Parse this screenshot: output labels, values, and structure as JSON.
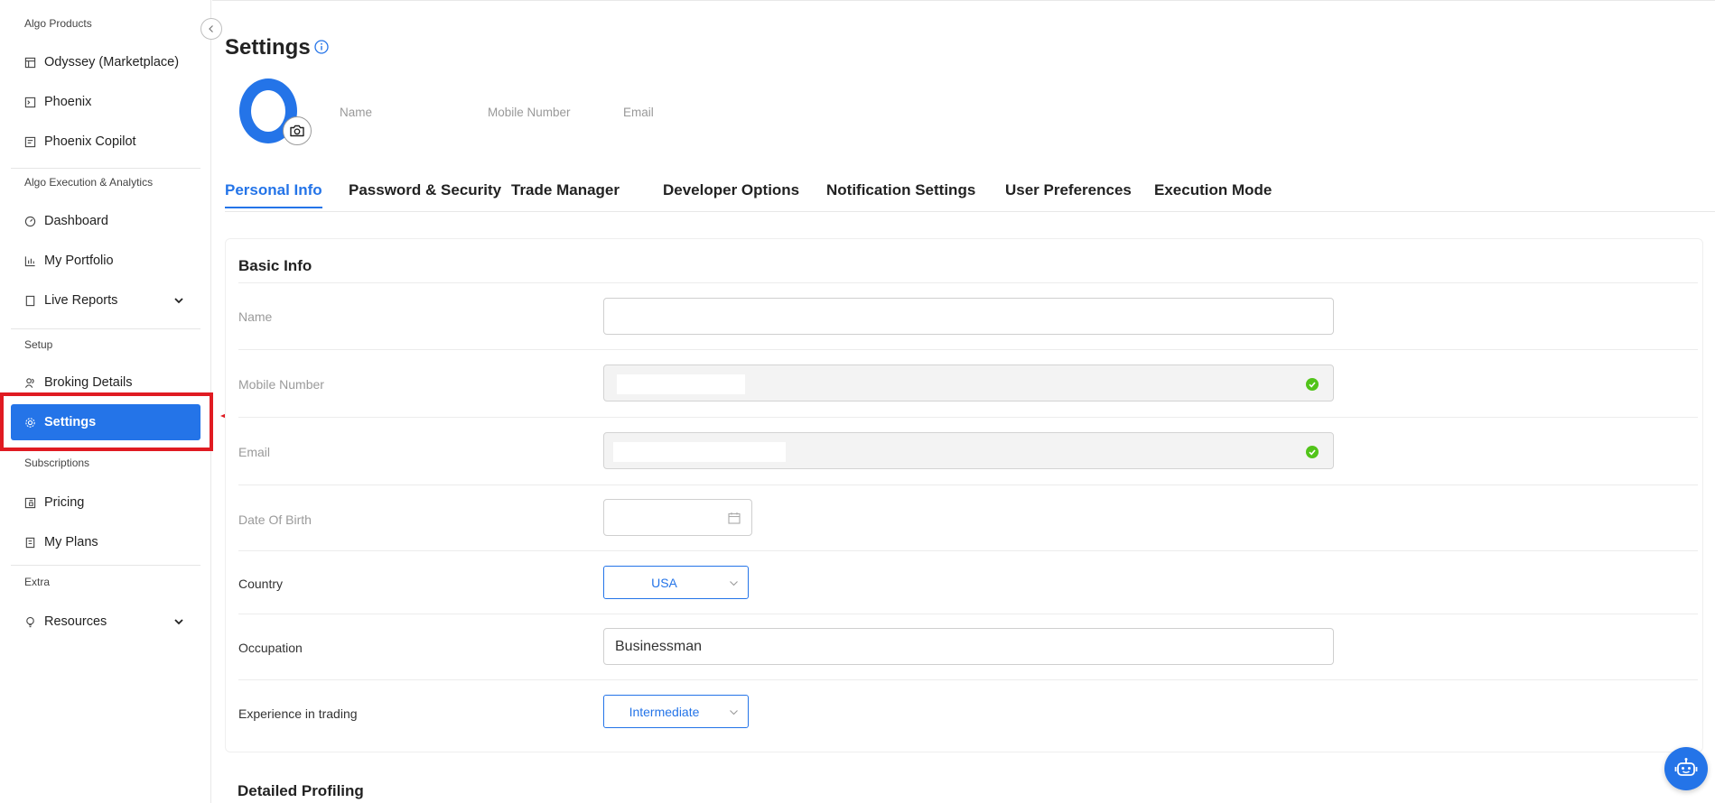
{
  "sidebar": {
    "sections": {
      "algo_products": "Algo Products",
      "algo_execution": "Algo Execution & Analytics",
      "setup": "Setup",
      "subscriptions": "Subscriptions",
      "extra": "Extra"
    },
    "items": [
      {
        "label": "Odyssey (Marketplace)",
        "icon": "store-icon"
      },
      {
        "label": "Phoenix",
        "icon": "terminal-icon"
      },
      {
        "label": "Phoenix Copilot",
        "icon": "document-icon"
      },
      {
        "label": "Dashboard",
        "icon": "dashboard-icon"
      },
      {
        "label": "My Portfolio",
        "icon": "bar-chart-icon"
      },
      {
        "label": "Live Reports",
        "icon": "report-icon"
      },
      {
        "label": "Broking Details",
        "icon": "users-icon"
      },
      {
        "label": "Settings",
        "icon": "gear-icon"
      },
      {
        "label": "Pricing",
        "icon": "pricing-icon"
      },
      {
        "label": "My Plans",
        "icon": "plans-icon"
      },
      {
        "label": "Resources",
        "icon": "lightbulb-icon"
      }
    ],
    "active_item": "Settings"
  },
  "header": {
    "title": "Settings"
  },
  "profile": {
    "name_label": "Name",
    "mobile_label": "Mobile Number",
    "email_label": "Email"
  },
  "tabs": [
    {
      "label": "Personal Info",
      "active": true
    },
    {
      "label": "Password & Security",
      "active": false
    },
    {
      "label": "Trade Manager",
      "active": false
    },
    {
      "label": "Developer Options",
      "active": false
    },
    {
      "label": "Notification Settings",
      "active": false
    },
    {
      "label": "User Preferences",
      "active": false
    },
    {
      "label": "Execution Mode",
      "active": false
    }
  ],
  "basic_info": {
    "title": "Basic Info",
    "fields": {
      "name": {
        "label": "Name",
        "value": ""
      },
      "mobile": {
        "label": "Mobile Number",
        "value": ""
      },
      "email": {
        "label": "Email",
        "value": ""
      },
      "dob": {
        "label": "Date Of Birth",
        "value": ""
      },
      "country": {
        "label": "Country",
        "value": "USA"
      },
      "occupation": {
        "label": "Occupation",
        "value": "Businessman"
      },
      "experience": {
        "label": "Experience in trading",
        "value": "Intermediate"
      }
    }
  },
  "detailed_profiling": {
    "title": "Detailed Profiling"
  },
  "colors": {
    "accent": "#2474e8",
    "highlight": "#e01b22",
    "verified": "#52c41a"
  }
}
